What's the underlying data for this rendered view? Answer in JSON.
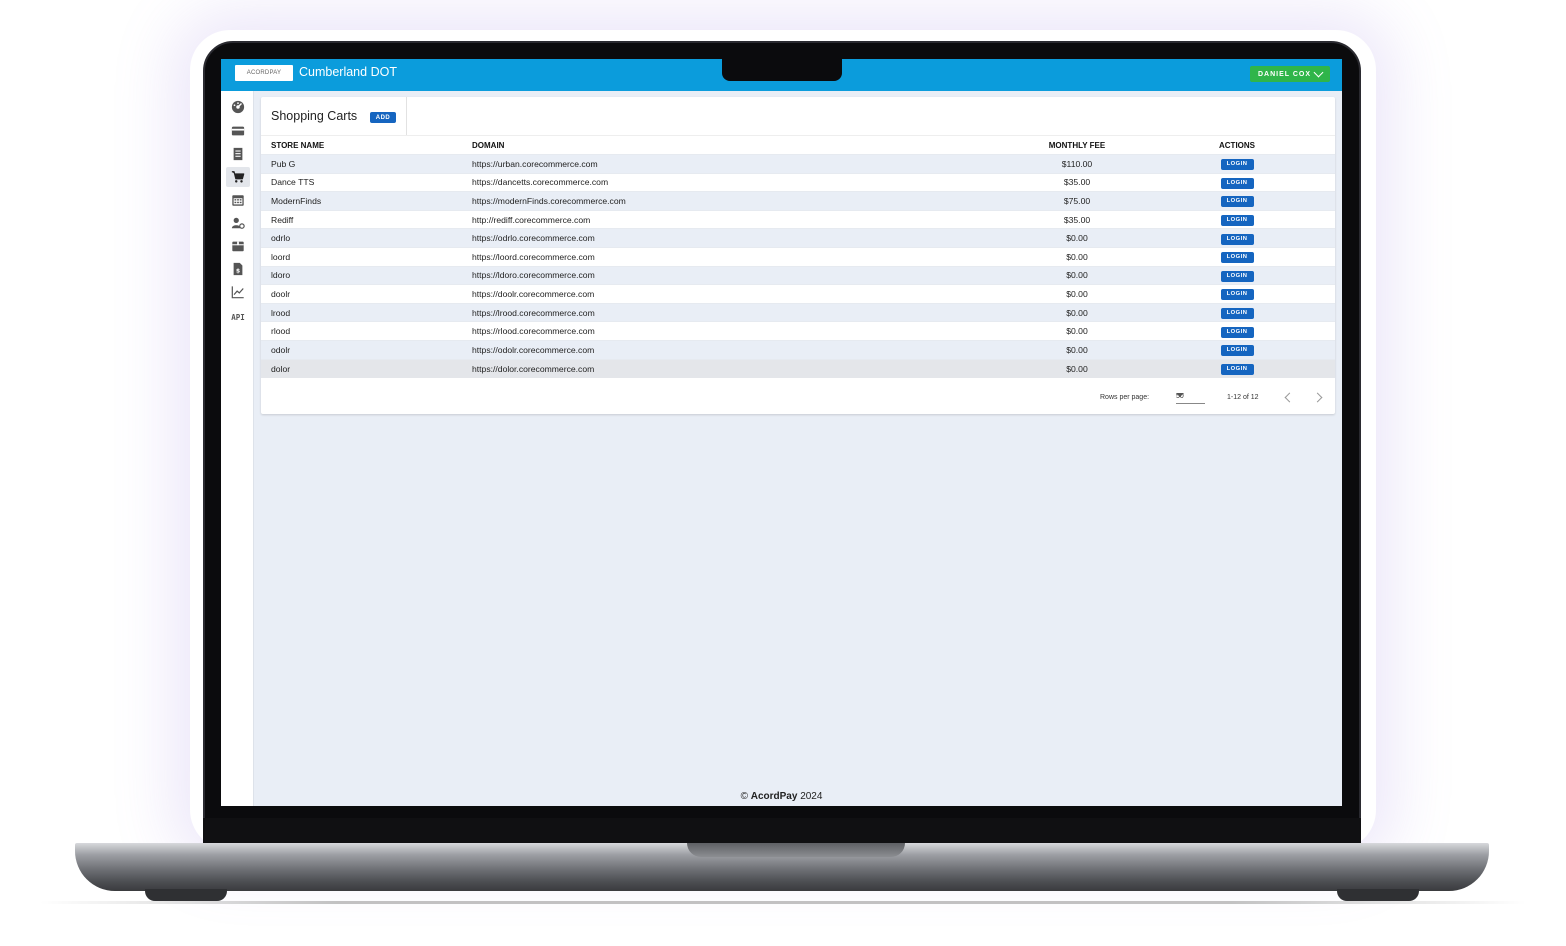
{
  "app": {
    "logo_text": "ACORDPAY",
    "title": "Cumberland DOT",
    "user_name": "DANIEL COX"
  },
  "sidebar": {
    "items": [
      {
        "icon": "dashboard-icon"
      },
      {
        "icon": "credit-card-icon"
      },
      {
        "icon": "receipt-icon"
      },
      {
        "icon": "shopping-cart-icon",
        "active": true
      },
      {
        "icon": "calendar-icon"
      },
      {
        "icon": "user-settings-icon"
      },
      {
        "icon": "package-icon"
      },
      {
        "icon": "invoice-icon"
      },
      {
        "icon": "analytics-icon"
      },
      {
        "label": "API"
      }
    ]
  },
  "page": {
    "title": "Shopping Carts",
    "add_label": "ADD"
  },
  "table": {
    "columns": [
      "STORE NAME",
      "DOMAIN",
      "MONTHLY FEE",
      "ACTIONS"
    ],
    "login_label": "LOGIN",
    "rows": [
      {
        "name": "Pub G",
        "domain": "https://urban.corecommerce.com",
        "fee": "$110.00"
      },
      {
        "name": "Dance TTS",
        "domain": "https://dancetts.corecommerce.com",
        "fee": "$35.00"
      },
      {
        "name": "ModernFinds",
        "domain": "https://modernFinds.corecommerce.com",
        "fee": "$75.00"
      },
      {
        "name": "Rediff",
        "domain": "http://rediff.corecommerce.com",
        "fee": "$35.00"
      },
      {
        "name": "odrlo",
        "domain": "https://odrlo.corecommerce.com",
        "fee": "$0.00"
      },
      {
        "name": "loord",
        "domain": "https://loord.corecommerce.com",
        "fee": "$0.00"
      },
      {
        "name": "ldoro",
        "domain": "https://ldoro.corecommerce.com",
        "fee": "$0.00"
      },
      {
        "name": "doolr",
        "domain": "https://doolr.corecommerce.com",
        "fee": "$0.00"
      },
      {
        "name": "lrood",
        "domain": "https://lrood.corecommerce.com",
        "fee": "$0.00"
      },
      {
        "name": "rlood",
        "domain": "https://rlood.corecommerce.com",
        "fee": "$0.00"
      },
      {
        "name": "odolr",
        "domain": "https://odolr.corecommerce.com",
        "fee": "$0.00"
      },
      {
        "name": "dolor",
        "domain": "https://dolor.corecommerce.com",
        "fee": "$0.00"
      }
    ]
  },
  "pagination": {
    "rows_label": "Rows per page:",
    "rows_value": "50",
    "range": "1-12 of 12"
  },
  "footer": {
    "copyright": "©",
    "brand": "AcordPay",
    "year": "2024"
  },
  "colors": {
    "header": "#0b9cdc",
    "user_button": "#2fb54a",
    "primary_button": "#1565c0",
    "background": "#e9eef6"
  }
}
